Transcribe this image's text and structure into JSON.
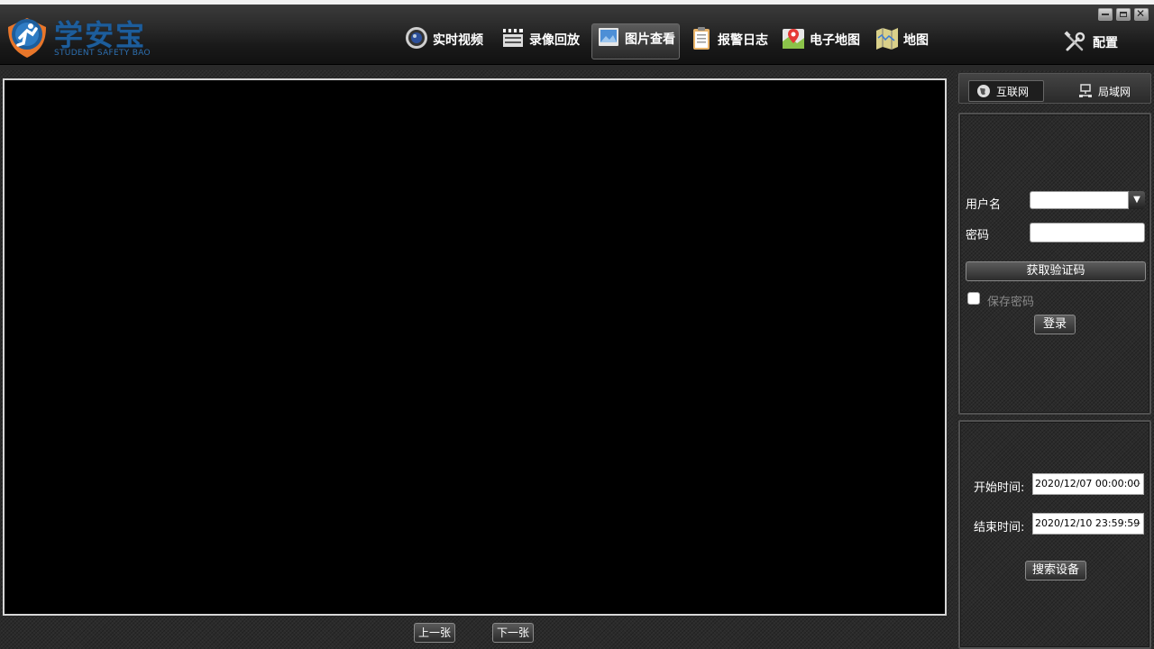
{
  "app": {
    "brand": "学安宝",
    "brand_sub": "STUDENT SAFETY BAO"
  },
  "nav": {
    "items": [
      {
        "label": "实时视频",
        "icon": "camera-icon"
      },
      {
        "label": "录像回放",
        "icon": "clapperboard-icon"
      },
      {
        "label": "图片查看",
        "icon": "image-icon"
      },
      {
        "label": "报警日志",
        "icon": "clipboard-icon"
      },
      {
        "label": "电子地图",
        "icon": "map-pin-icon"
      },
      {
        "label": "地图",
        "icon": "folded-map-icon"
      }
    ],
    "active_index": 2,
    "config_label": "配置"
  },
  "viewer": {
    "prev_label": "上一张",
    "next_label": "下一张"
  },
  "network_tabs": {
    "internet": "互联网",
    "lan": "局域网",
    "selected": "internet"
  },
  "login": {
    "username_label": "用户名",
    "username_value": "",
    "password_label": "密码",
    "password_value": "",
    "get_code_label": "获取验证码",
    "save_password_label": "保存密码",
    "save_password_checked": false,
    "login_label": "登录"
  },
  "search": {
    "start_label": "开始时间:",
    "start_value": "2020/12/07 00:00:00",
    "end_label": "结束时间:",
    "end_value": "2020/12/10 23:59:59",
    "search_label": "搜索设备"
  },
  "colors": {
    "brand": "#1d5d9b",
    "background": "#2b2b2b"
  }
}
